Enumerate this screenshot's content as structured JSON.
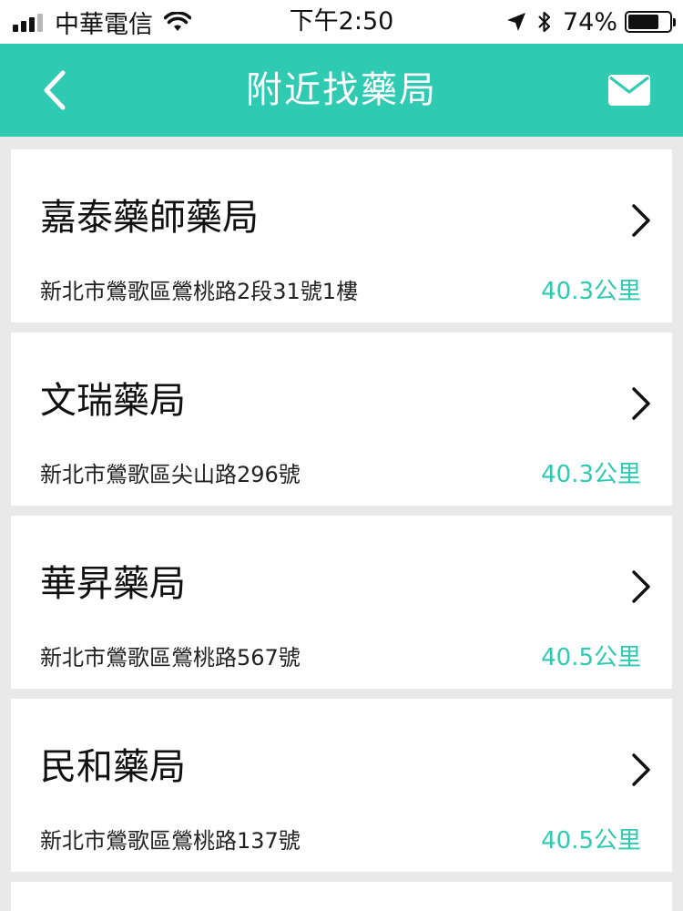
{
  "status": {
    "carrier": "中華電信",
    "time": "下午2:50",
    "battery": "74%",
    "battery_level": 0.74
  },
  "header": {
    "title": "附近找藥局",
    "back_icon": "chevron-left-icon",
    "mail_icon": "envelope-icon"
  },
  "colors": {
    "accent": "#2ecab1",
    "background": "#e9e9e9"
  },
  "pharmacies": [
    {
      "name": "嘉泰藥師藥局",
      "address": "新北市鶯歌區鶯桃路2段31號1樓",
      "distance": "40.3公里"
    },
    {
      "name": "文瑞藥局",
      "address": "新北市鶯歌區尖山路296號",
      "distance": "40.3公里"
    },
    {
      "name": "華昇藥局",
      "address": "新北市鶯歌區鶯桃路567號",
      "distance": "40.5公里"
    },
    {
      "name": "民和藥局",
      "address": "新北市鶯歌區鶯桃路137號",
      "distance": "40.5公里"
    }
  ]
}
